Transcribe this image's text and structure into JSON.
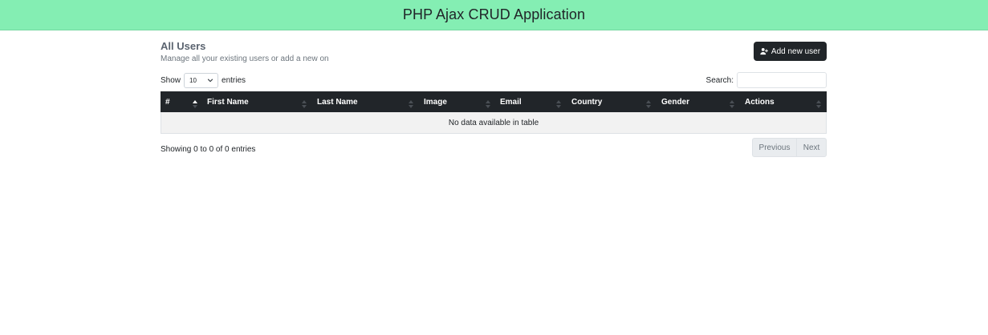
{
  "navbar": {
    "title": "PHP Ajax CRUD Application"
  },
  "header": {
    "title": "All Users",
    "subtitle": "Manage all your existing users or add a new on",
    "add_button_label": "Add new user",
    "add_button_icon": "user-plus-icon"
  },
  "controls": {
    "show_label": "Show",
    "entries_value": "10",
    "entries_label": "entries",
    "search_label": "Search:",
    "search_value": ""
  },
  "table": {
    "columns": [
      "#",
      "First Name",
      "Last Name",
      "Image",
      "Email",
      "Country",
      "Gender",
      "Actions"
    ],
    "empty_message": "No data available in table",
    "header_color": "#212529"
  },
  "footer": {
    "info": "Showing 0 to 0 of 0 entries",
    "previous_label": "Previous",
    "next_label": "Next"
  },
  "colors": {
    "navbar_bg": "#84eeb3",
    "primary_dark": "#212529"
  }
}
